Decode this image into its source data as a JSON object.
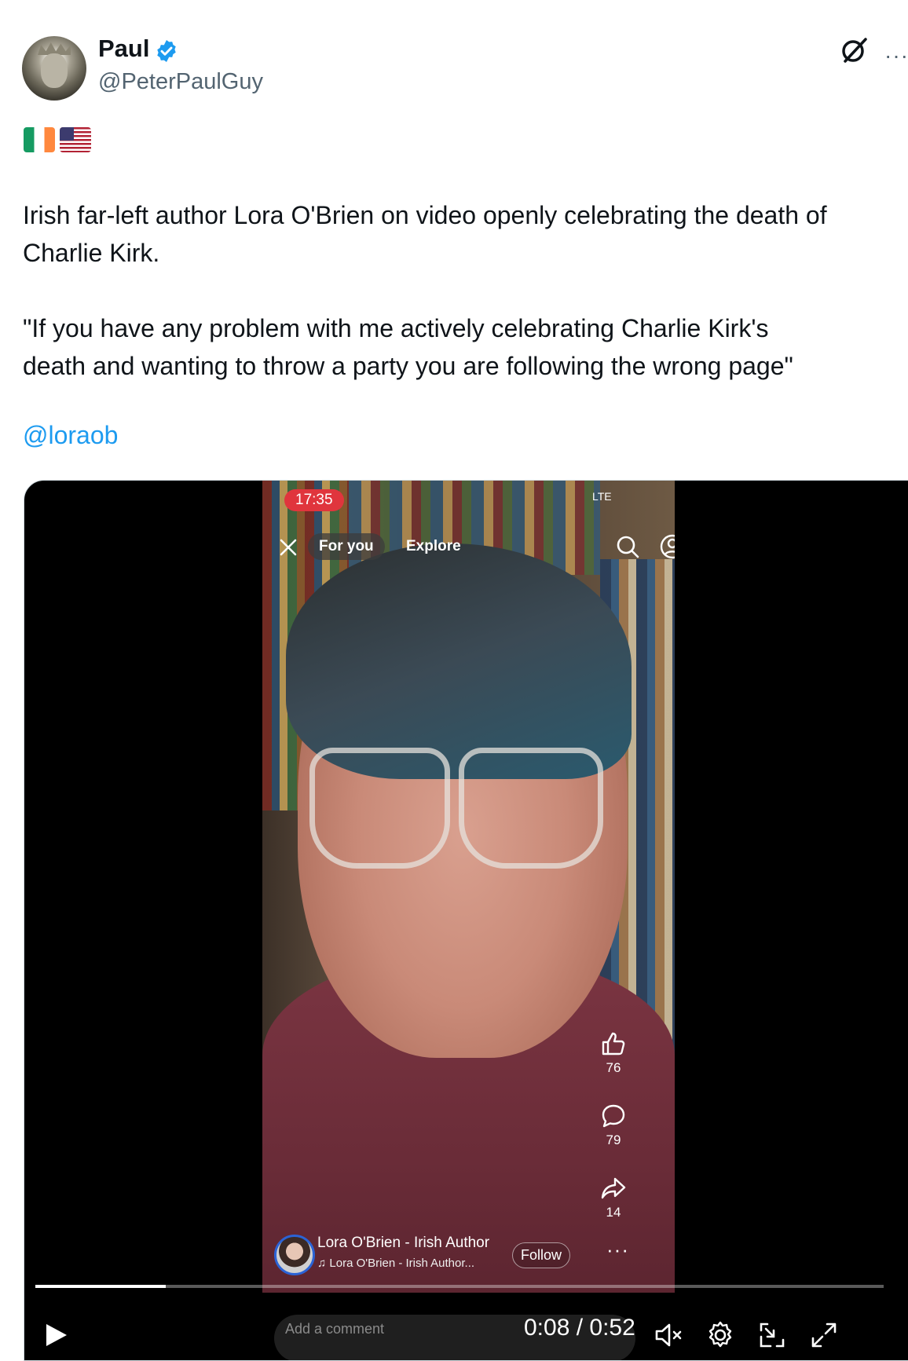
{
  "post": {
    "author_name": "Paul",
    "author_handle": "@PeterPaulGuy",
    "flags": [
      "flag-ireland",
      "flag-united-states"
    ],
    "text_lines": [
      "Irish far-left author Lora O'Brien on video openly celebrating the death of",
      "Charlie Kirk.",
      "\"If you have any problem with me actively celebrating Charlie Kirk's",
      "death and wanting to throw a party you are following the wrong page\""
    ],
    "mention": "@loraob",
    "header_icons": [
      "grok-icon",
      "more-icon"
    ],
    "more_label": "···",
    "accent_color": "#1d9bf0"
  },
  "video": {
    "status_time": "17:35",
    "status_network": "LTE",
    "tabs": [
      "For you",
      "Explore"
    ],
    "actions": [
      {
        "icon": "thumbs-up-icon",
        "count": "76"
      },
      {
        "icon": "comment-icon",
        "count": "79"
      },
      {
        "icon": "share-icon",
        "count": "14"
      }
    ],
    "creator_name": "Lora O'Brien - Irish Author",
    "creator_sound": "Lora O'Brien - Irish Author...",
    "follow_label": "Follow",
    "more_label": "···",
    "comment_placeholder": "Add a comment"
  },
  "player": {
    "current_time": "0:08",
    "duration": "0:52",
    "time_display": "0:08 / 0:52",
    "progress_fraction": 0.154,
    "controls": [
      "play-icon",
      "mute-icon",
      "settings-icon",
      "pip-icon",
      "fullscreen-icon"
    ]
  }
}
